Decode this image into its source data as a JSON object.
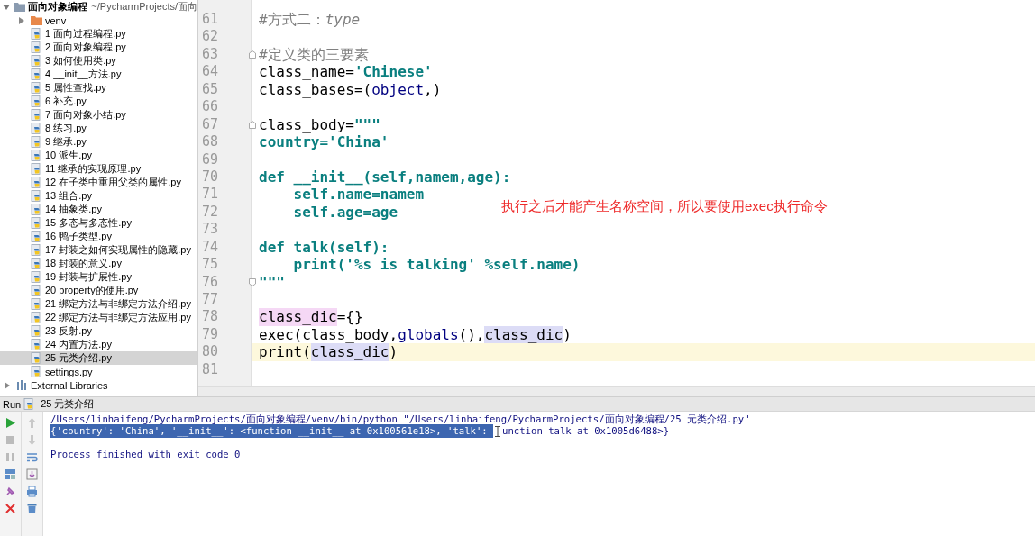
{
  "project": {
    "name": "面向对象编程",
    "path": "~/PycharmProjects/面向",
    "expanded": true,
    "children": [
      {
        "name": "venv",
        "kind": "folder",
        "expanded": false,
        "selected": false
      },
      {
        "name": "1 面向过程编程.py",
        "kind": "python",
        "selected": false
      },
      {
        "name": "2 面向对象编程.py",
        "kind": "python",
        "selected": false
      },
      {
        "name": "3 如何使用类.py",
        "kind": "python",
        "selected": false
      },
      {
        "name": "4 __init__方法.py",
        "kind": "python",
        "selected": false
      },
      {
        "name": "5 属性查找.py",
        "kind": "python",
        "selected": false
      },
      {
        "name": "6 补充.py",
        "kind": "python",
        "selected": false
      },
      {
        "name": "7 面向对象小结.py",
        "kind": "python",
        "selected": false
      },
      {
        "name": "8 练习.py",
        "kind": "python",
        "selected": false
      },
      {
        "name": "9 继承.py",
        "kind": "python",
        "selected": false
      },
      {
        "name": "10 派生.py",
        "kind": "python",
        "selected": false
      },
      {
        "name": "11 继承的实现原理.py",
        "kind": "python",
        "selected": false
      },
      {
        "name": "12 在子类中重用父类的属性.py",
        "kind": "python",
        "selected": false
      },
      {
        "name": "13 组合.py",
        "kind": "python",
        "selected": false
      },
      {
        "name": "14 抽象类.py",
        "kind": "python",
        "selected": false
      },
      {
        "name": "15 多态与多态性.py",
        "kind": "python",
        "selected": false
      },
      {
        "name": "16 鸭子类型.py",
        "kind": "python",
        "selected": false
      },
      {
        "name": "17 封装之如何实现属性的隐藏.py",
        "kind": "python",
        "selected": false
      },
      {
        "name": "18 封装的意义.py",
        "kind": "python",
        "selected": false
      },
      {
        "name": "19 封装与扩展性.py",
        "kind": "python",
        "selected": false
      },
      {
        "name": "20 property的使用.py",
        "kind": "python",
        "selected": false
      },
      {
        "name": "21 绑定方法与非绑定方法介绍.py",
        "kind": "python",
        "selected": false
      },
      {
        "name": "22 绑定方法与非绑定方法应用.py",
        "kind": "python",
        "selected": false
      },
      {
        "name": "23 反射.py",
        "kind": "python",
        "selected": false
      },
      {
        "name": "24 内置方法.py",
        "kind": "python",
        "selected": false
      },
      {
        "name": "25 元类介绍.py",
        "kind": "python",
        "selected": true
      },
      {
        "name": "settings.py",
        "kind": "python",
        "selected": false
      }
    ]
  },
  "external_libraries": {
    "name": "External Libraries",
    "expanded": false
  },
  "editor": {
    "lines": [
      {
        "number": "61",
        "current": false,
        "tokens": [
          {
            "text": "#方式二：",
            "kind": "comment"
          },
          {
            "text": "type",
            "kind": "comment-italic"
          }
        ]
      },
      {
        "number": "62",
        "current": false
      },
      {
        "number": "63",
        "current": false,
        "fold_start": true,
        "tokens": [
          {
            "text": "#定义类的三要素",
            "kind": "comment"
          }
        ]
      },
      {
        "number": "64",
        "current": false,
        "tokens": [
          {
            "text": "class_name=",
            "kind": "plain"
          },
          {
            "text": "'Chinese'",
            "kind": "string"
          }
        ]
      },
      {
        "number": "65",
        "current": false,
        "tokens": [
          {
            "text": "class_bases=(",
            "kind": "plain"
          },
          {
            "text": "object",
            "kind": "builtin"
          },
          {
            "text": ",)",
            "kind": "plain"
          }
        ]
      },
      {
        "number": "66",
        "current": false
      },
      {
        "number": "67",
        "current": false,
        "fold_start": true,
        "tokens": [
          {
            "text": "class_body=",
            "kind": "plain"
          },
          {
            "text": "\"\"\"",
            "kind": "string"
          }
        ]
      },
      {
        "number": "68",
        "current": false,
        "tokens": [
          {
            "text": "country='China'",
            "kind": "string"
          }
        ]
      },
      {
        "number": "69",
        "current": false
      },
      {
        "number": "70",
        "current": false,
        "tokens": [
          {
            "text": "def __init__(self,namem,age):",
            "kind": "string"
          }
        ]
      },
      {
        "number": "71",
        "current": false,
        "tokens": [
          {
            "text": "    self.name=namem",
            "kind": "string"
          }
        ]
      },
      {
        "number": "72",
        "current": false,
        "tokens": [
          {
            "text": "    self.age=age",
            "kind": "string"
          }
        ]
      },
      {
        "number": "73",
        "current": false
      },
      {
        "number": "74",
        "current": false,
        "tokens": [
          {
            "text": "def talk(self):",
            "kind": "string"
          }
        ]
      },
      {
        "number": "75",
        "current": false,
        "tokens": [
          {
            "text": "    print('%s is talking' %self.name)",
            "kind": "string"
          }
        ]
      },
      {
        "number": "76",
        "current": false,
        "fold_end": true,
        "tokens": [
          {
            "text": "\"\"\"",
            "kind": "string"
          }
        ]
      },
      {
        "number": "77",
        "current": false
      },
      {
        "number": "78",
        "current": false,
        "tokens": [
          {
            "text": "class_dic",
            "kind": "plain",
            "write_highlight": true
          },
          {
            "text": "={}",
            "kind": "plain"
          }
        ]
      },
      {
        "number": "79",
        "current": false,
        "tokens": [
          {
            "text": "exec(class_body,",
            "kind": "plain"
          },
          {
            "text": "globals",
            "kind": "builtin"
          },
          {
            "text": "(),",
            "kind": "plain"
          },
          {
            "text": "class_dic",
            "kind": "plain",
            "read_highlight": true
          },
          {
            "text": ")",
            "kind": "plain"
          }
        ]
      },
      {
        "number": "80",
        "current": true,
        "tokens": [
          {
            "text": "print(",
            "kind": "plain"
          },
          {
            "text": "class_dic",
            "kind": "plain",
            "read_highlight": true
          },
          {
            "text": ")",
            "kind": "plain"
          }
        ]
      },
      {
        "number": "81",
        "current": false
      }
    ],
    "annotation": {
      "text": "执行之后才能产生名称空间，所以要使用exec执行命令",
      "color": "#ee2a2a"
    }
  },
  "run": {
    "title": "Run",
    "config": "25 元类介绍",
    "output": [
      {
        "segments": [
          {
            "text": "/Users/linhaifeng/PycharmProjects/面向对象编程/venv/bin/python \"/Users/linhaifeng/PycharmProjects/面向对象编程/25 元类介绍.py\"",
            "selected": false
          }
        ]
      },
      {
        "segments": [
          {
            "text": "{'country': 'China', '__init__': <function __init__ at 0x100561e18>, 'talk': ",
            "selected": true
          },
          {
            "text": "unction talk at 0x1005d6488>}",
            "selected": false
          }
        ]
      },
      {
        "segments": [
          {
            "text": "Process finished with exit code 0",
            "selected": false
          }
        ]
      }
    ]
  }
}
